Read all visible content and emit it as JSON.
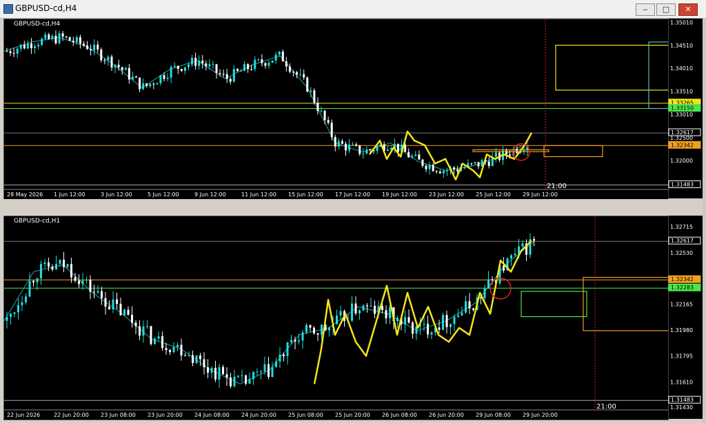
{
  "window": {
    "title": "GBPUSD-cd,H4",
    "min": "‒",
    "restore": "□",
    "close": "✕"
  },
  "colors": {
    "bg": "#000000",
    "bull": "#22dddd",
    "bear": "#ffffff",
    "ma": "#1fa7a7",
    "yellow": "#f2e51a",
    "orange": "#f0a020",
    "green": "#4ce64c",
    "red": "#dd2222"
  },
  "top": {
    "label": "GBPUSD-cd,H4",
    "price_labels": [
      {
        "text": "1.35010",
        "value": 1.3501
      },
      {
        "text": "1.34510",
        "value": 1.3451
      },
      {
        "text": "1.34010",
        "value": 1.3401
      },
      {
        "text": "1.33510",
        "value": 1.3351
      },
      {
        "text": "1.33010",
        "value": 1.3301
      },
      {
        "text": "1.32500",
        "value": 1.325
      },
      {
        "text": "1.32000",
        "value": 1.32
      }
    ],
    "markers": [
      {
        "text": "1.33265",
        "value": 1.33265,
        "bg": "#f2e51a",
        "fg": "#000"
      },
      {
        "text": "1.33150",
        "value": 1.3315,
        "bg": "#4ce64c",
        "fg": "#000"
      },
      {
        "text": "1.32617",
        "value": 1.32617,
        "bg": "#000",
        "fg": "#fff",
        "border": "#ffffff"
      },
      {
        "text": "1.32342",
        "value": 1.32342,
        "bg": "#f0a020",
        "fg": "#000"
      },
      {
        "text": "1.31483",
        "value": 1.31483,
        "bg": "#000",
        "fg": "#fff",
        "border": "#ffffff"
      }
    ],
    "time_labels": [
      "28 May 2026",
      "1 Jun 12:00",
      "3 Jun 12:00",
      "5 Jun 12:00",
      "9 Jun 12:00",
      "11 Jun 12:00",
      "15 Jun 12:00",
      "17 Jun 12:00",
      "19 Jun 12:00",
      "23 Jun 12:00",
      "25 Jun 12:00",
      "29 Jun 12:00"
    ],
    "vline_label": "21:00"
  },
  "bottom": {
    "label": "GBPUSD-cd,H1",
    "price_labels": [
      {
        "text": "1.32715",
        "value": 1.32715
      },
      {
        "text": "1.32530",
        "value": 1.3253
      },
      {
        "text": "1.32165",
        "value": 1.32165
      },
      {
        "text": "1.31980",
        "value": 1.3198
      },
      {
        "text": "1.31795",
        "value": 1.31795
      },
      {
        "text": "1.31610",
        "value": 1.3161
      },
      {
        "text": "1.31430",
        "value": 1.3143
      }
    ],
    "markers": [
      {
        "text": "1.32617",
        "value": 1.32617,
        "bg": "#000",
        "fg": "#fff",
        "border": "#ffffff"
      },
      {
        "text": "1.32342",
        "value": 1.32342,
        "bg": "#f0a020",
        "fg": "#000"
      },
      {
        "text": "1.32283",
        "value": 1.32283,
        "bg": "#4ce64c",
        "fg": "#000"
      },
      {
        "text": "1.31483",
        "value": 1.31483,
        "bg": "#000",
        "fg": "#fff",
        "border": "#ffffff"
      }
    ],
    "time_labels": [
      "22 Jun 2026",
      "22 Jun 20:00",
      "23 Jun 08:00",
      "23 Jun 20:00",
      "24 Jun 08:00",
      "24 Jun 20:00",
      "25 Jun 08:00",
      "25 Jun 20:00",
      "26 Jun 08:00",
      "26 Jun 20:00",
      "29 Jun 08:00",
      "29 Jun 20:00"
    ],
    "vline_label": "21:00"
  },
  "chart_data": [
    {
      "type": "candlestick",
      "title": "GBPUSD-cd,H4",
      "ylim": [
        1.3143,
        1.3505
      ],
      "x": [
        "28 May 2026",
        "1 Jun 12:00",
        "3 Jun 12:00",
        "5 Jun 12:00",
        "9 Jun 12:00",
        "11 Jun 12:00",
        "15 Jun 12:00",
        "17 Jun 12:00",
        "19 Jun 12:00",
        "23 Jun 12:00",
        "25 Jun 12:00",
        "29 Jun 12:00"
      ],
      "close": [
        1.343,
        1.346,
        1.344,
        1.34,
        1.338,
        1.339,
        1.341,
        1.326,
        1.325,
        1.318,
        1.321,
        1.3262
      ],
      "horizontal_levels": [
        1.33265,
        1.3315,
        1.32617,
        1.32342,
        1.31483
      ],
      "grid": false
    },
    {
      "type": "candlestick",
      "title": "GBPUSD-cd,H1",
      "ylim": [
        1.3143,
        1.3278
      ],
      "x": [
        "22 Jun 2026",
        "22 Jun 20:00",
        "23 Jun 08:00",
        "23 Jun 20:00",
        "24 Jun 08:00",
        "24 Jun 20:00",
        "25 Jun 08:00",
        "25 Jun 20:00",
        "26 Jun 08:00",
        "26 Jun 20:00",
        "29 Jun 08:00",
        "29 Jun 20:00"
      ],
      "close": [
        1.3205,
        1.3243,
        1.3222,
        1.3195,
        1.3175,
        1.3168,
        1.3172,
        1.3195,
        1.321,
        1.3195,
        1.3215,
        1.3262
      ],
      "horizontal_levels": [
        1.32617,
        1.32342,
        1.32283,
        1.31483
      ],
      "grid": false
    }
  ]
}
